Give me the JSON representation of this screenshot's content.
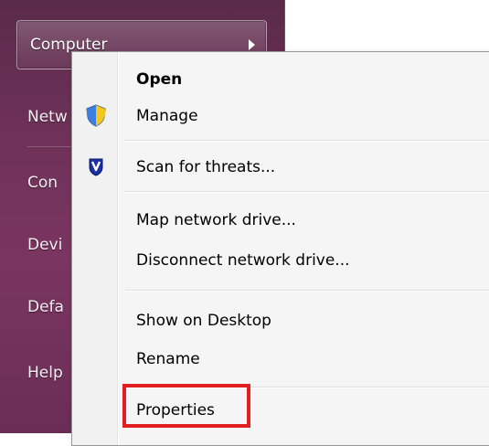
{
  "start_menu": {
    "items": [
      {
        "label": "Computer"
      },
      {
        "label": "Netw"
      },
      {
        "label": "Con"
      },
      {
        "label": "Devi"
      },
      {
        "label": "Defa"
      },
      {
        "label": "Help"
      }
    ]
  },
  "context_menu": {
    "items": [
      {
        "label": "Open",
        "bold": true
      },
      {
        "label": "Manage",
        "icon": "uac-shield-icon"
      },
      {
        "label": "Scan for threats...",
        "icon": "antivirus-shield-icon"
      },
      {
        "label": "Map network drive..."
      },
      {
        "label": "Disconnect network drive..."
      },
      {
        "label": "Show on Desktop"
      },
      {
        "label": "Rename"
      },
      {
        "label": "Properties",
        "highlighted": true
      }
    ]
  },
  "colors": {
    "highlight": "#e02020",
    "start_pane": "#6e3158"
  }
}
